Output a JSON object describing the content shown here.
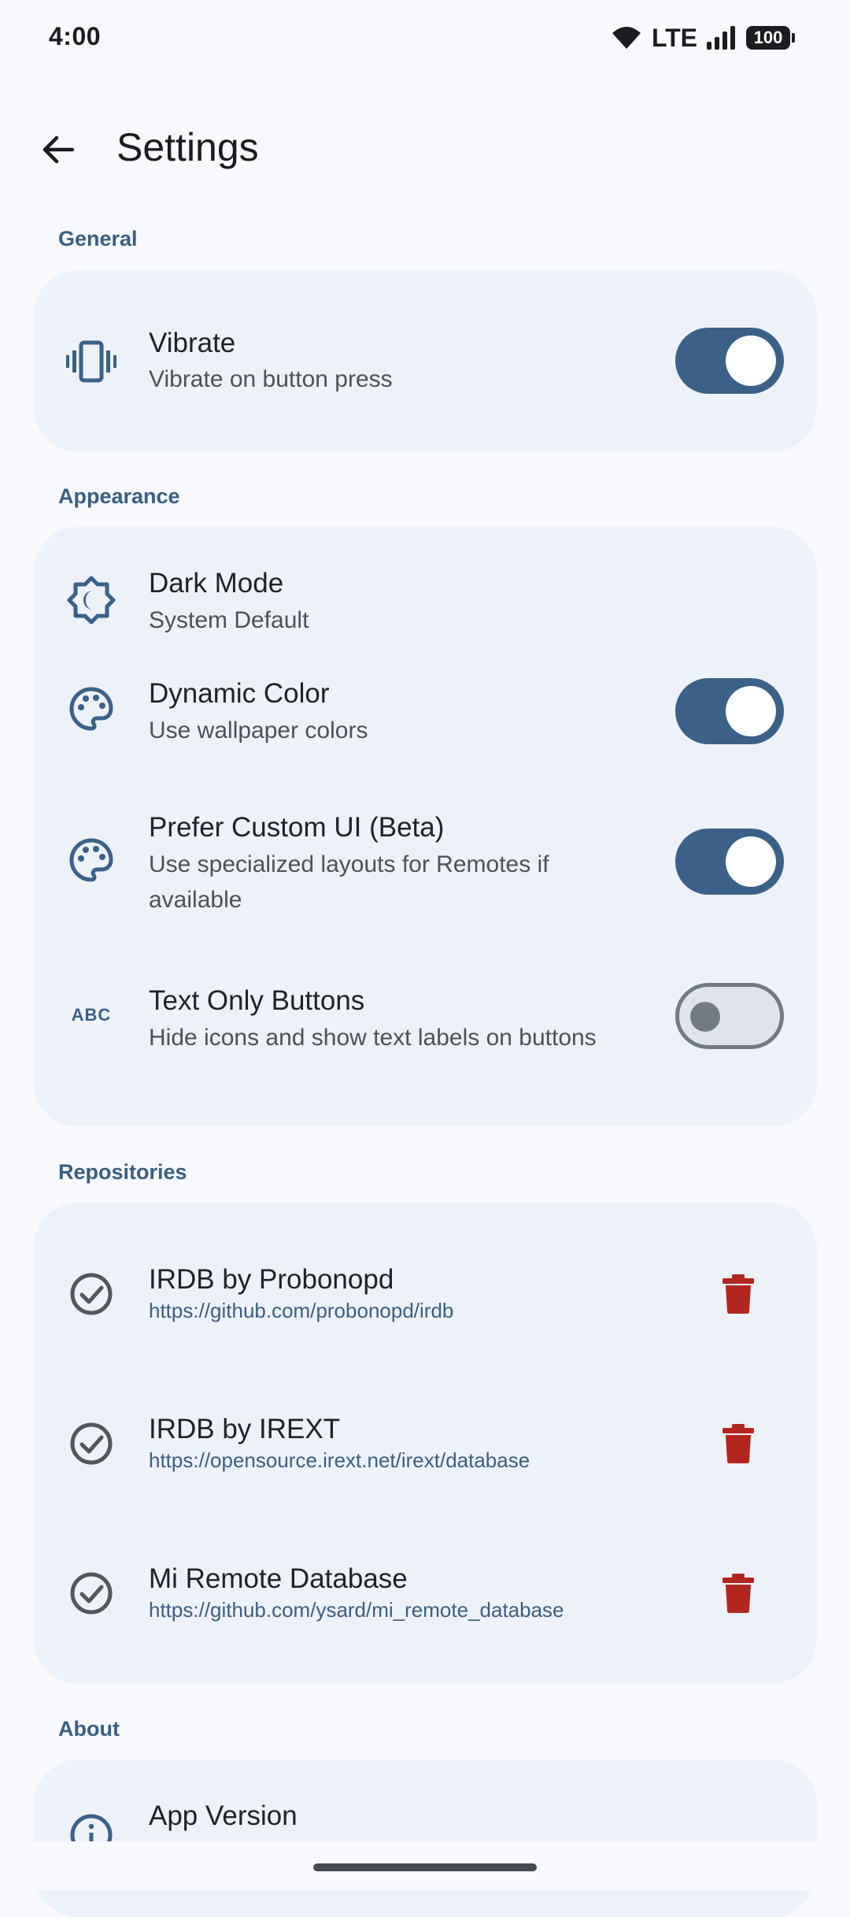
{
  "status_bar": {
    "time": "4:00",
    "network": "LTE",
    "battery": "100",
    "icons": [
      "wifi-icon",
      "signal-icon",
      "battery-icon"
    ]
  },
  "app_bar": {
    "title": "Settings",
    "back_icon": "arrow-back-icon"
  },
  "sections": {
    "general": {
      "header": "General",
      "vibrate": {
        "title": "Vibrate",
        "subtitle": "Vibrate on button press",
        "enabled": true,
        "icon": "vibration-icon"
      }
    },
    "appearance": {
      "header": "Appearance",
      "dark_mode": {
        "title": "Dark Mode",
        "subtitle": "System Default",
        "icon": "brightness-icon"
      },
      "dynamic_color": {
        "title": "Dynamic Color",
        "subtitle": "Use wallpaper colors",
        "enabled": true,
        "icon": "palette-icon"
      },
      "custom_ui": {
        "title": "Prefer Custom UI (Beta)",
        "subtitle_line1": "Use specialized layouts for Remotes if",
        "subtitle_line2": "available",
        "enabled": true,
        "icon": "palette-icon"
      },
      "text_only": {
        "title": "Text Only Buttons",
        "subtitle": "Hide icons and show text labels on buttons",
        "enabled": false,
        "icon": "abc-icon",
        "icon_text": "ABC"
      }
    },
    "repositories": {
      "header": "Repositories",
      "items": [
        {
          "title": "IRDB by Probonopd",
          "url": "https://github.com/probonopd/irdb"
        },
        {
          "title": "IRDB by IREXT",
          "url": "https://opensource.irext.net/irext/database"
        },
        {
          "title": "Mi Remote Database",
          "url": "https://github.com/ysard/mi_remote_database"
        }
      ]
    },
    "about": {
      "header": "About",
      "app_version": {
        "title": "App Version"
      }
    }
  },
  "colors": {
    "accent": "#3a6189",
    "section_header": "#3a5f82",
    "delete": "#b3261e",
    "card_bg": "#edf1f8",
    "page_bg": "#f7f9fd"
  }
}
